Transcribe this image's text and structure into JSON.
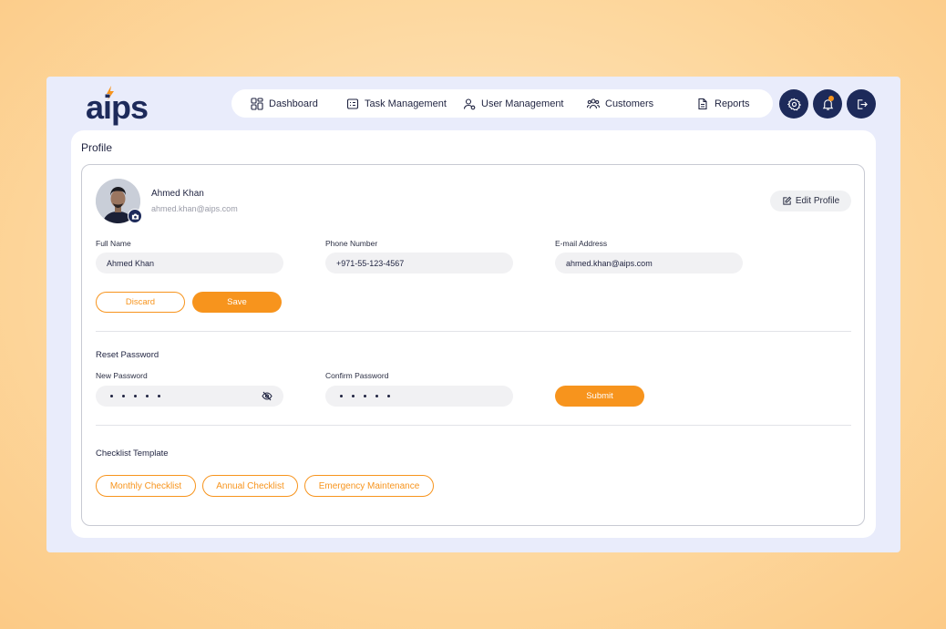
{
  "app": {
    "logo_text": "aips"
  },
  "nav": {
    "items": [
      {
        "label": "Dashboard",
        "icon": "dashboard-icon"
      },
      {
        "label": "Task Management",
        "icon": "task-icon"
      },
      {
        "label": "User Management",
        "icon": "user-icon"
      },
      {
        "label": "Customers",
        "icon": "customers-icon"
      },
      {
        "label": "Reports",
        "icon": "reports-icon"
      }
    ]
  },
  "header_actions": [
    "settings-icon",
    "notification-bell-icon",
    "logout-icon"
  ],
  "page": {
    "title": "Profile"
  },
  "profile": {
    "name": "Ahmed Khan",
    "email": "ahmed.khan@aips.com",
    "edit_label": "Edit Profile"
  },
  "form": {
    "full_name_label": "Full Name",
    "full_name_value": "Ahmed Khan",
    "phone_label": "Phone Number",
    "phone_value": "+971-55-123-4567",
    "email_label": "E-mail Address",
    "email_value": "ahmed.khan@aips.com",
    "discard_label": "Discard",
    "save_label": "Save"
  },
  "password": {
    "title": "Reset Password",
    "new_label": "New Password",
    "confirm_label": "Confirm Password",
    "submit_label": "Submit"
  },
  "checklist": {
    "title": "Checklist Template",
    "items": [
      "Monthly Checklist",
      "Annual Checklist",
      "Emergency Maintenance"
    ]
  },
  "colors": {
    "accent": "#f7941d",
    "navy": "#1d2a5a",
    "panel": "#e9ecfb"
  }
}
